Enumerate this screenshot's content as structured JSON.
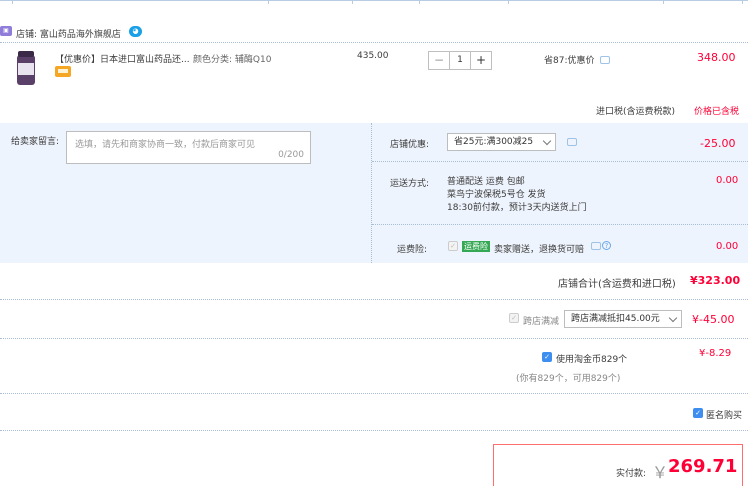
{
  "shop": {
    "label": "店铺:",
    "name": "富山药品海外旗舰店"
  },
  "item": {
    "title": "【优惠价】日本进口富山药品还...",
    "attr_label": "颜色分类:",
    "attr_value": "辅酶Q10",
    "unit_price": "435.00",
    "quantity": "1",
    "discount_note": "省87:优惠价",
    "subtotal": "348.00",
    "import_tax_label": "进口税(含运费税款)",
    "import_tax_value": "价格已含税"
  },
  "message": {
    "label": "给卖家留言:",
    "placeholder": "选填，请先和商家协商一致，付款后商家可见",
    "count": "0/200"
  },
  "shop_discount": {
    "label": "店铺优惠:",
    "option": "省25元:满300减25",
    "value": "-25.00"
  },
  "shipping": {
    "label": "运送方式:",
    "line1": "普通配送 运费 包邮",
    "line2": "菜鸟宁波保税5号仓  发货",
    "line3": "18:30前付款，预计3天内送货上门",
    "value": "0.00"
  },
  "insurance": {
    "label": "运费险:",
    "tag": "运费险",
    "text": "卖家赠送，退换货可赔",
    "value": "0.00"
  },
  "shop_total": {
    "label": "店铺合计(含运费和进口税)",
    "value": "¥323.00"
  },
  "cross_store": {
    "label": "跨店满减",
    "option": "跨店满减抵扣45.00元",
    "value": "¥-45.00"
  },
  "taojinbi": {
    "label": "使用淘金币829个",
    "note": "(你有829个，可用829个)",
    "value": "¥-8.29"
  },
  "anonymous": {
    "label": "匿名购买"
  },
  "pay": {
    "label": "实付款:",
    "currency": "￥",
    "amount": "269.71"
  },
  "colors": {
    "accent": "#ff0036",
    "panel_bg": "#eef4fd",
    "link_blue": "#3d8ef0"
  }
}
